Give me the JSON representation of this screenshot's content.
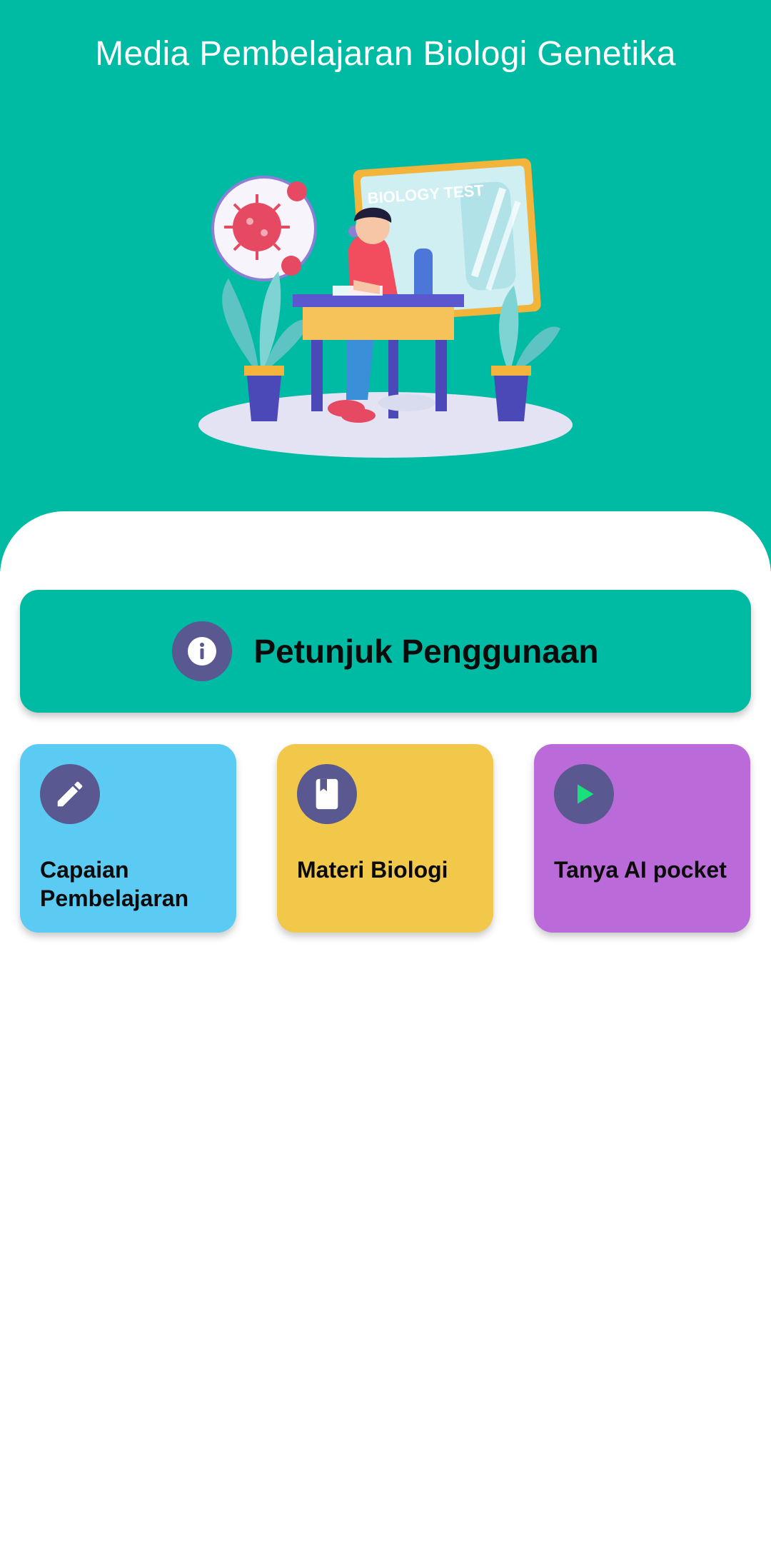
{
  "header": {
    "title": "Media Pembelajaran Biologi Genetika",
    "background": "#00BBA4"
  },
  "hero": {
    "board_text": "BIOLOGY TEST"
  },
  "help_button": {
    "label": "Petunjuk Penggunaan",
    "icon": "info-icon"
  },
  "menu": [
    {
      "label": "Capaian Pembelajaran",
      "icon": "pencil-icon",
      "color": "#5BCBF4"
    },
    {
      "label": "Materi Biologi",
      "icon": "book-icon",
      "color": "#F2C84B"
    },
    {
      "label": "Tanya AI pocket",
      "icon": "play-icon",
      "color": "#BA6BD9"
    }
  ],
  "colors": {
    "icon_circle": "#5A5890",
    "play_accent": "#19E07A"
  }
}
